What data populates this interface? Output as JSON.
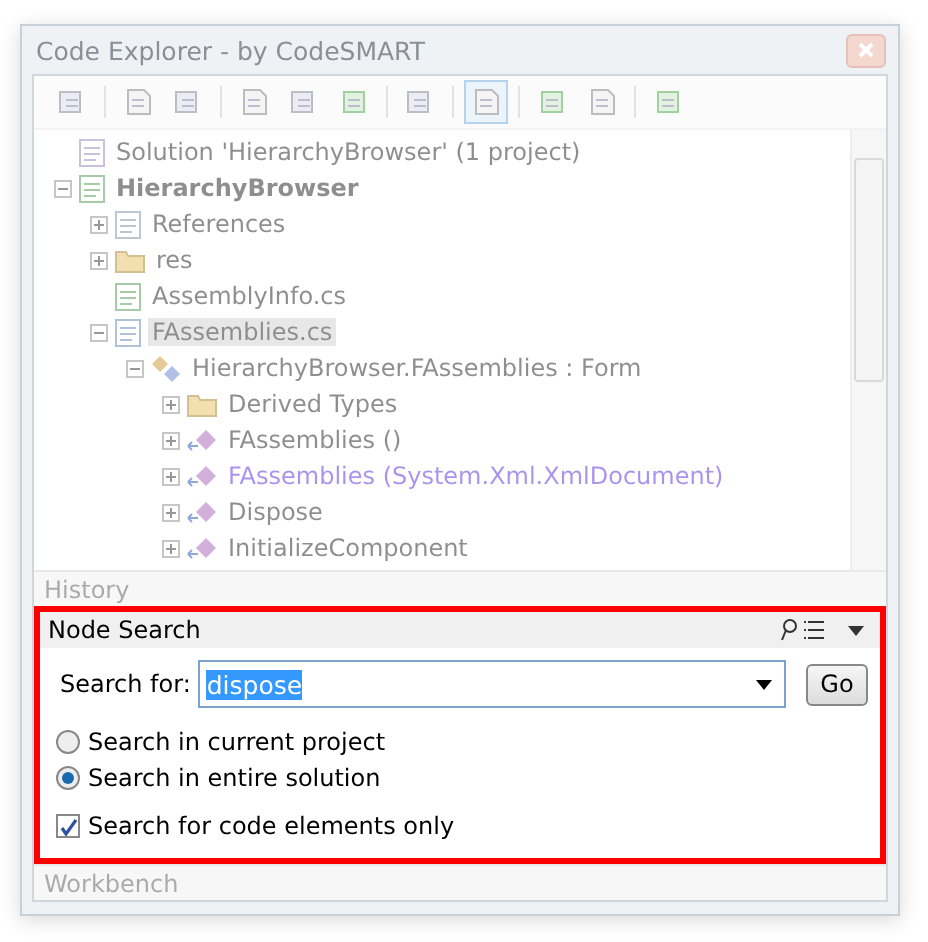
{
  "window": {
    "title": "Code Explorer - by CodeSMART"
  },
  "toolbar": [
    {
      "kind": "button",
      "pressed": false
    },
    {
      "kind": "separator"
    },
    {
      "kind": "button",
      "pressed": false
    },
    {
      "kind": "button",
      "pressed": false
    },
    {
      "kind": "separator"
    },
    {
      "kind": "button",
      "pressed": false
    },
    {
      "kind": "button",
      "pressed": false
    },
    {
      "kind": "button",
      "pressed": false
    },
    {
      "kind": "separator"
    },
    {
      "kind": "button",
      "pressed": false
    },
    {
      "kind": "separator"
    },
    {
      "kind": "button",
      "pressed": true
    },
    {
      "kind": "separator"
    },
    {
      "kind": "button",
      "pressed": false
    },
    {
      "kind": "button",
      "pressed": false
    },
    {
      "kind": "separator"
    },
    {
      "kind": "button",
      "pressed": false
    }
  ],
  "tree": [
    {
      "label": "Solution 'HierarchyBrowser' (1 project)",
      "kind": "solution",
      "selected": false,
      "highlighted": false,
      "children": [
        {
          "label": "HierarchyBrowser",
          "kind": "project",
          "selected": false,
          "highlighted": false,
          "expanded": true,
          "children": [
            {
              "label": "References",
              "kind": "references",
              "selected": false,
              "highlighted": false,
              "expanded": false
            },
            {
              "label": "res",
              "kind": "folder",
              "selected": false,
              "highlighted": false,
              "expanded": false
            },
            {
              "label": "AssemblyInfo.cs",
              "kind": "csfile",
              "selected": false,
              "highlighted": false
            },
            {
              "label": "FAssemblies.cs",
              "kind": "form",
              "selected": true,
              "highlighted": false,
              "expanded": true,
              "children": [
                {
                  "label": "HierarchyBrowser.FAssemblies : Form",
                  "kind": "class",
                  "selected": false,
                  "highlighted": false,
                  "expanded": true,
                  "children": [
                    {
                      "label": "Derived Types",
                      "kind": "folder",
                      "selected": false,
                      "highlighted": false,
                      "expanded": false
                    },
                    {
                      "label": "FAssemblies ()",
                      "kind": "constructor",
                      "selected": false,
                      "highlighted": false,
                      "expanded": false
                    },
                    {
                      "label": "FAssemblies (System.Xml.XmlDocument)",
                      "kind": "constructor",
                      "selected": false,
                      "highlighted": true,
                      "expanded": false
                    },
                    {
                      "label": "Dispose",
                      "kind": "method",
                      "selected": false,
                      "highlighted": false,
                      "expanded": false
                    },
                    {
                      "label": "InitializeComponent",
                      "kind": "method",
                      "selected": false,
                      "highlighted": false,
                      "expanded": false
                    }
                  ]
                }
              ]
            }
          ]
        }
      ]
    }
  ],
  "history": {
    "title": "History"
  },
  "node_search": {
    "title": "Node Search",
    "search_label": "Search for:",
    "search_value": "dispose",
    "go": "Go",
    "options": [
      {
        "label": "Search in current project",
        "selected": false
      },
      {
        "label": "Search in entire solution",
        "selected": true
      }
    ],
    "code_only": {
      "label": "Search for code elements only",
      "checked": true
    }
  },
  "workbench": {
    "title": "Workbench"
  }
}
